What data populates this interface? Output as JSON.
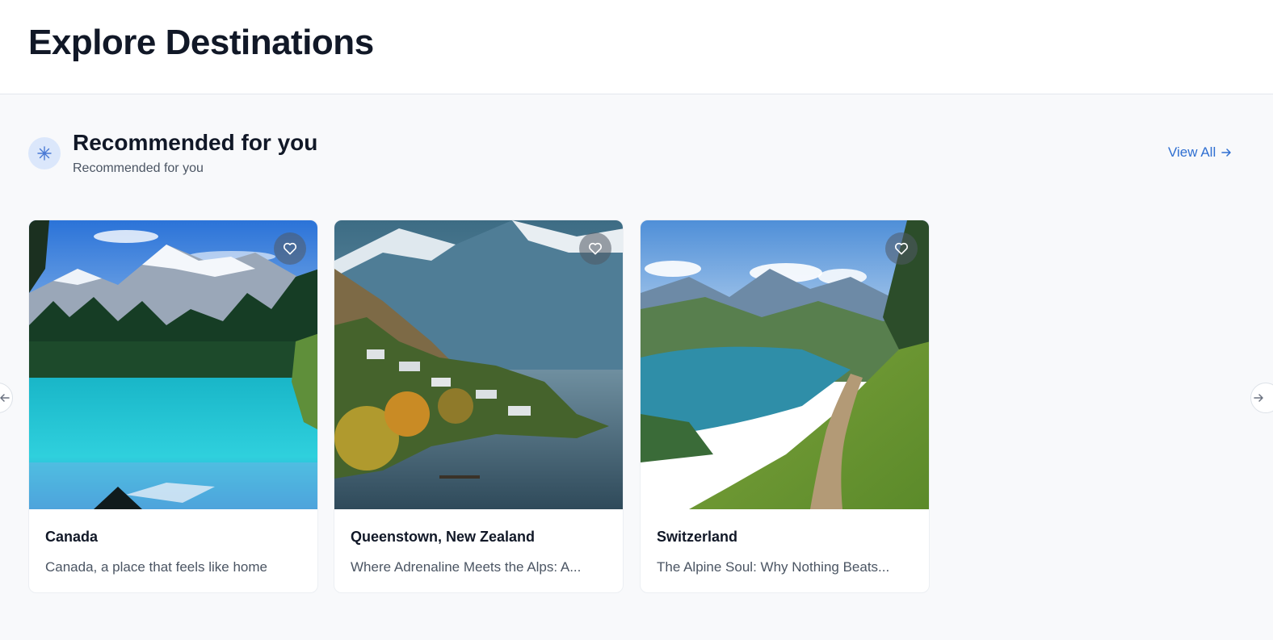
{
  "header": {
    "title": "Explore Destinations"
  },
  "section": {
    "icon": "sparkle-icon",
    "title": "Recommended for you",
    "subtitle": "Recommended for you",
    "view_all_label": "View All",
    "view_all_icon": "arrow-right-icon"
  },
  "carousel": {
    "prev_icon": "arrow-left-icon",
    "next_icon": "arrow-right-icon",
    "cards": [
      {
        "title": "Canada",
        "description": "Canada, a place that feels like home",
        "favorite_icon": "heart-icon"
      },
      {
        "title": "Queenstown, New Zealand",
        "description": "Where Adrenaline Meets the Alps: A...",
        "favorite_icon": "heart-icon"
      },
      {
        "title": "Switzerland",
        "description": "The Alpine Soul: Why Nothing Beats...",
        "favorite_icon": "heart-icon"
      }
    ]
  },
  "colors": {
    "accent": "#2f6fd1",
    "background": "#f8f9fb",
    "title": "#111827"
  }
}
